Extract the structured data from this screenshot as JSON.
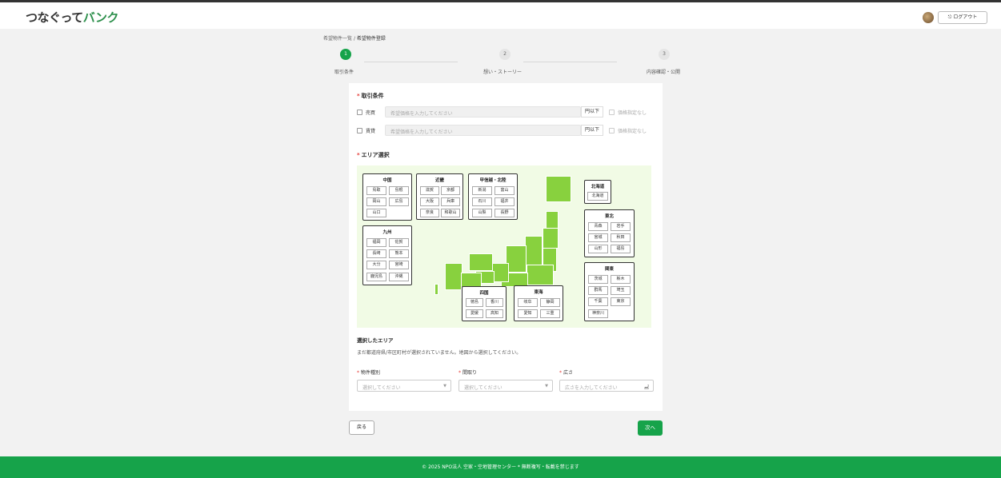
{
  "header": {
    "logo_a": "つなぐって",
    "logo_b": "バンク",
    "logout_label": "ログアウト",
    "logout_icon": "logout-icon"
  },
  "breadcrumb": {
    "parent": "希望物件一覧",
    "separator": "/",
    "current": "希望物件登録"
  },
  "steps": [
    {
      "num": "1",
      "label": "取引条件"
    },
    {
      "num": "2",
      "label": "想い・ストーリー"
    },
    {
      "num": "3",
      "label": "内容確認・公開"
    }
  ],
  "conditions": {
    "title": "取引条件",
    "rows": [
      {
        "type": "売買",
        "placeholder": "希望価格を入力してください",
        "unit": "円以下",
        "no_price": "価格指定なし"
      },
      {
        "type": "賃貸",
        "placeholder": "希望価格を入力してください",
        "unit": "円以下",
        "no_price": "価格指定なし"
      }
    ]
  },
  "area": {
    "title": "エリア選択",
    "regions": {
      "chugoku": {
        "name": "中国",
        "prefs": [
          "鳥取",
          "島根",
          "岡山",
          "広島",
          "山口"
        ]
      },
      "kinki": {
        "name": "近畿",
        "prefs": [
          "滋賀",
          "京都",
          "大阪",
          "兵庫",
          "奈良",
          "和歌山"
        ]
      },
      "koshinetsu": {
        "name": "甲信越・北陸",
        "prefs": [
          "新潟",
          "富山",
          "石川",
          "福井",
          "山梨",
          "長野"
        ]
      },
      "hokkaido": {
        "name": "北海道",
        "prefs": [
          "北海道"
        ]
      },
      "tohoku": {
        "name": "東北",
        "prefs": [
          "青森",
          "岩手",
          "宮城",
          "秋田",
          "山形",
          "福島"
        ]
      },
      "kyushu": {
        "name": "九州",
        "prefs": [
          "福岡",
          "佐賀",
          "長崎",
          "熊本",
          "大分",
          "宮崎",
          "鹿児島",
          "沖縄"
        ]
      },
      "shikoku": {
        "name": "四国",
        "prefs": [
          "徳島",
          "香川",
          "愛媛",
          "高知"
        ]
      },
      "tokai": {
        "name": "東海",
        "prefs": [
          "岐阜",
          "静岡",
          "愛知",
          "三重"
        ]
      },
      "kanto": {
        "name": "関東",
        "prefs": [
          "茨城",
          "栃木",
          "群馬",
          "埼玉",
          "千葉",
          "東京",
          "神奈川"
        ]
      }
    },
    "selected_title": "選択したエリア",
    "selected_message": "まだ都道府県/市区町村が選択されていません。地図から選択してください。"
  },
  "filters": {
    "property_type": {
      "label": "物件種別",
      "placeholder": "選択してください"
    },
    "layout": {
      "label": "間取り",
      "placeholder": "選択してください"
    },
    "size": {
      "label": "広さ",
      "placeholder": "広さを入力してください",
      "unit": "㎡"
    }
  },
  "buttons": {
    "back": "戻る",
    "next": "次へ"
  },
  "footer": {
    "text": "© 2025 NPO法人 空家・空地管理センター * 無断複写・転載を禁じます"
  },
  "colors": {
    "brand_green": "#16a34a",
    "map_land": "#88d13e",
    "map_bg": "#f1fbe5",
    "required": "#e53935"
  }
}
